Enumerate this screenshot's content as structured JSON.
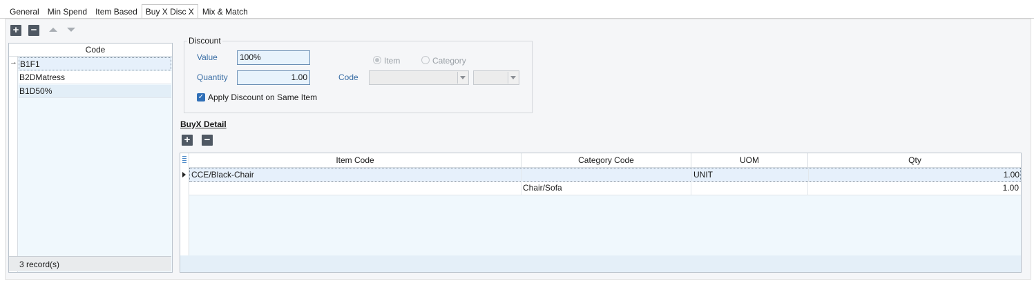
{
  "tabs": [
    "General",
    "Min Spend",
    "Item Based",
    "Buy X Disc X",
    "Mix & Match"
  ],
  "active_tab": "Buy X Disc X",
  "toolbar": {
    "icons": [
      "add-icon",
      "remove-icon",
      "move-up-icon",
      "move-down-icon"
    ]
  },
  "code_grid": {
    "header": "Code",
    "rows": [
      "B1F1",
      "B2DMatress",
      "B1D50%"
    ],
    "footer": "3 record(s)"
  },
  "discount": {
    "legend": "Discount",
    "value_label": "Value",
    "value": "100%",
    "quantity_label": "Quantity",
    "quantity": "1.00",
    "code_label": "Code",
    "radio_item": "Item",
    "radio_category": "Category",
    "apply_same_item_label": "Apply Discount on Same Item",
    "apply_same_item_checked": true
  },
  "buyx_detail": {
    "title": "BuyX Detail",
    "columns": [
      "Item Code",
      "Category Code",
      "UOM",
      "Qty"
    ],
    "rows": [
      {
        "item_code": "CCE/Black-Chair",
        "category_code": "",
        "uom": "UNIT",
        "qty": "1.00"
      },
      {
        "item_code": "",
        "category_code": "Chair/Sofa",
        "uom": "",
        "qty": "1.00"
      }
    ]
  },
  "colors": {
    "accent": "#2f6fb7",
    "label_blue": "#3a6ea5",
    "grid_bg": "#f0f8fd"
  }
}
